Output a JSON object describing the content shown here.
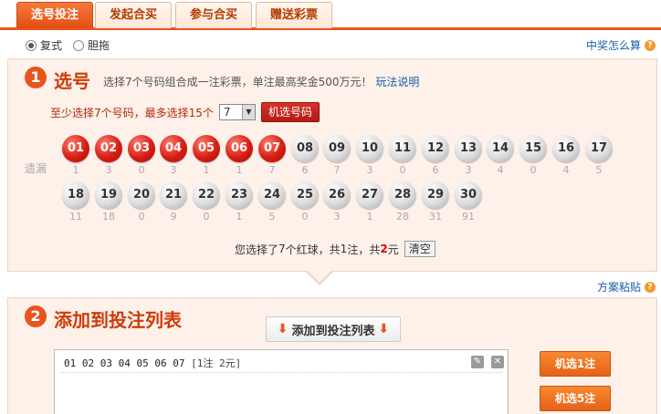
{
  "tabs": [
    {
      "label": "选号投注",
      "active": true
    },
    {
      "label": "发起合买",
      "active": false
    },
    {
      "label": "参与合买",
      "active": false
    },
    {
      "label": "赠送彩票",
      "active": false
    }
  ],
  "mode": {
    "options": [
      {
        "label": "复式",
        "checked": true
      },
      {
        "label": "胆拖",
        "checked": false
      }
    ],
    "help_link": "中奖怎么算"
  },
  "step1": {
    "num": "1",
    "title": "选号",
    "desc": "选择7个号码组合成一注彩票，单注最高奖金500万元！",
    "desc_link": "玩法说明",
    "pick_text": "至少选择7个号码，最多选择15个",
    "pick_select": "7",
    "random_pick_button": "机选号码",
    "miss_label": "遗漏",
    "balls": [
      {
        "n": "01",
        "miss": "1",
        "selected": true
      },
      {
        "n": "02",
        "miss": "3",
        "selected": true
      },
      {
        "n": "03",
        "miss": "0",
        "selected": true
      },
      {
        "n": "04",
        "miss": "3",
        "selected": true
      },
      {
        "n": "05",
        "miss": "1",
        "selected": true
      },
      {
        "n": "06",
        "miss": "1",
        "selected": true
      },
      {
        "n": "07",
        "miss": "7",
        "selected": true
      },
      {
        "n": "08",
        "miss": "6",
        "selected": false
      },
      {
        "n": "09",
        "miss": "7",
        "selected": false
      },
      {
        "n": "10",
        "miss": "3",
        "selected": false
      },
      {
        "n": "11",
        "miss": "0",
        "selected": false
      },
      {
        "n": "12",
        "miss": "6",
        "selected": false
      },
      {
        "n": "13",
        "miss": "3",
        "selected": false
      },
      {
        "n": "14",
        "miss": "4",
        "selected": false
      },
      {
        "n": "15",
        "miss": "0",
        "selected": false
      },
      {
        "n": "16",
        "miss": "4",
        "selected": false
      },
      {
        "n": "17",
        "miss": "5",
        "selected": false
      },
      {
        "n": "18",
        "miss": "11",
        "selected": false
      },
      {
        "n": "19",
        "miss": "18",
        "selected": false
      },
      {
        "n": "20",
        "miss": "0",
        "selected": false
      },
      {
        "n": "21",
        "miss": "9",
        "selected": false
      },
      {
        "n": "22",
        "miss": "0",
        "selected": false
      },
      {
        "n": "23",
        "miss": "1",
        "selected": false
      },
      {
        "n": "24",
        "miss": "5",
        "selected": false
      },
      {
        "n": "25",
        "miss": "0",
        "selected": false
      },
      {
        "n": "26",
        "miss": "3",
        "selected": false
      },
      {
        "n": "27",
        "miss": "1",
        "selected": false
      },
      {
        "n": "28",
        "miss": "28",
        "selected": false
      },
      {
        "n": "29",
        "miss": "31",
        "selected": false
      },
      {
        "n": "30",
        "miss": "91",
        "selected": false
      }
    ],
    "summary": {
      "prefix": "您选择了",
      "count": "7",
      "mid1": "个红球，共",
      "bets": "1",
      "mid2": "注，共",
      "amount": "2",
      "suffix": "元",
      "clear_button": "清空"
    }
  },
  "paste_link": "方案粘贴",
  "step2": {
    "num": "2",
    "title": "添加到投注列表",
    "add_button": "添加到投注列表",
    "bet_lines": [
      {
        "numbers": "01 02 03 04 05 06 07",
        "meta": "[1注 2元]"
      }
    ],
    "random_buttons": [
      "机选1注",
      "机选5注"
    ]
  },
  "colors": {
    "accent": "#e8541e",
    "red_ball": "#d81e12",
    "link": "#1a5fa8"
  }
}
